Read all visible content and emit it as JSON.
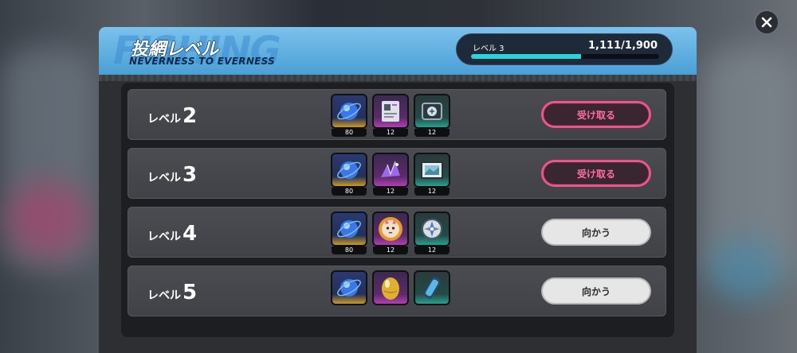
{
  "header": {
    "title": "投網レベル",
    "subtitle": "NEVERNESS TO EVERNESS",
    "watermark": "FISHING",
    "level_label": "レベル 3",
    "xp_text": "1,111/1,900",
    "xp_progress": 0.585
  },
  "colors": {
    "header_blue": "#5aaee0",
    "claim_pink": "#f0528a",
    "xp_cyan": "#2ad4d8"
  },
  "rows": [
    {
      "prefix": "レベル",
      "level": "2",
      "button": "受け取る",
      "button_type": "claim",
      "rewards": [
        {
          "icon": "blue-orb-icon",
          "qty": "80",
          "rarity": "gold"
        },
        {
          "icon": "document-card-icon",
          "qty": "12",
          "rarity": "purple"
        },
        {
          "icon": "tablet-device-icon",
          "qty": "12",
          "rarity": "teal"
        }
      ]
    },
    {
      "prefix": "レベル",
      "level": "3",
      "button": "受け取る",
      "button_type": "claim",
      "rewards": [
        {
          "icon": "blue-orb-icon",
          "qty": "80",
          "rarity": "gold"
        },
        {
          "icon": "crystal-cluster-icon",
          "qty": "12",
          "rarity": "purple"
        },
        {
          "icon": "picture-frame-icon",
          "qty": "12",
          "rarity": "teal"
        }
      ]
    },
    {
      "prefix": "レベル",
      "level": "4",
      "button": "向かう",
      "button_type": "go",
      "rewards": [
        {
          "icon": "blue-orb-icon",
          "qty": "80",
          "rarity": "gold"
        },
        {
          "icon": "cat-badge-icon",
          "qty": "12",
          "rarity": "purple"
        },
        {
          "icon": "compass-icon",
          "qty": "12",
          "rarity": "teal"
        }
      ]
    },
    {
      "prefix": "レベル",
      "level": "5",
      "button": "向かう",
      "button_type": "go",
      "rewards": [
        {
          "icon": "blue-orb-icon",
          "qty": "",
          "rarity": "gold"
        },
        {
          "icon": "gold-egg-icon",
          "qty": "",
          "rarity": "purple"
        },
        {
          "icon": "energy-cylinder-icon",
          "qty": "",
          "rarity": "teal"
        }
      ]
    }
  ]
}
